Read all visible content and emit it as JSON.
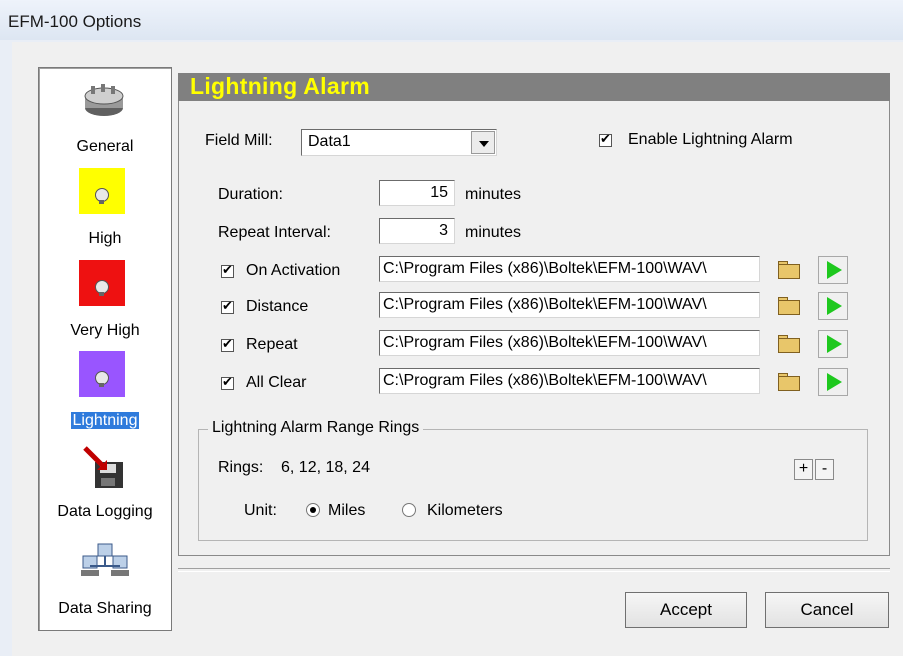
{
  "window": {
    "title": "EFM-100 Options"
  },
  "sidebar": {
    "items": [
      {
        "label": "General",
        "icon": "network-device-icon"
      },
      {
        "label": "High",
        "icon": "yellow-alarm-icon",
        "color": "#ffff00"
      },
      {
        "label": "Very High",
        "icon": "red-alarm-icon",
        "color": "#ee1111"
      },
      {
        "label": "Lightning",
        "icon": "purple-alarm-icon",
        "color": "#9955ff",
        "selected": true
      },
      {
        "label": "Data Logging",
        "icon": "disk-logging-icon"
      },
      {
        "label": "Data Sharing",
        "icon": "network-share-icon"
      }
    ]
  },
  "panel": {
    "title": "Lightning Alarm",
    "field_mill_label": "Field Mill:",
    "field_mill_value": "Data1",
    "enable_label": "Enable Lightning Alarm",
    "enable_checked": true,
    "duration_label": "Duration:",
    "duration_value": "15",
    "duration_unit": "minutes",
    "repeat_interval_label": "Repeat Interval:",
    "repeat_interval_value": "3",
    "repeat_interval_unit": "minutes",
    "sounds": [
      {
        "label": "On Activation",
        "checked": true,
        "path": "C:\\Program Files (x86)\\Boltek\\EFM-100\\WAV\\"
      },
      {
        "label": "Distance",
        "checked": true,
        "path": "C:\\Program Files (x86)\\Boltek\\EFM-100\\WAV\\"
      },
      {
        "label": "Repeat",
        "checked": true,
        "path": "C:\\Program Files (x86)\\Boltek\\EFM-100\\WAV\\"
      },
      {
        "label": "All Clear",
        "checked": true,
        "path": "C:\\Program Files (x86)\\Boltek\\EFM-100\\WAV\\"
      }
    ]
  },
  "rings": {
    "group_label": "Lightning Alarm Range Rings",
    "rings_label": "Rings:",
    "rings_value": "6, 12, 18, 24",
    "add_label": "+",
    "remove_label": "-",
    "unit_label": "Unit:",
    "unit_options": [
      "Miles",
      "Kilometers"
    ],
    "unit_selected": "Miles"
  },
  "buttons": {
    "accept": "Accept",
    "cancel": "Cancel"
  }
}
